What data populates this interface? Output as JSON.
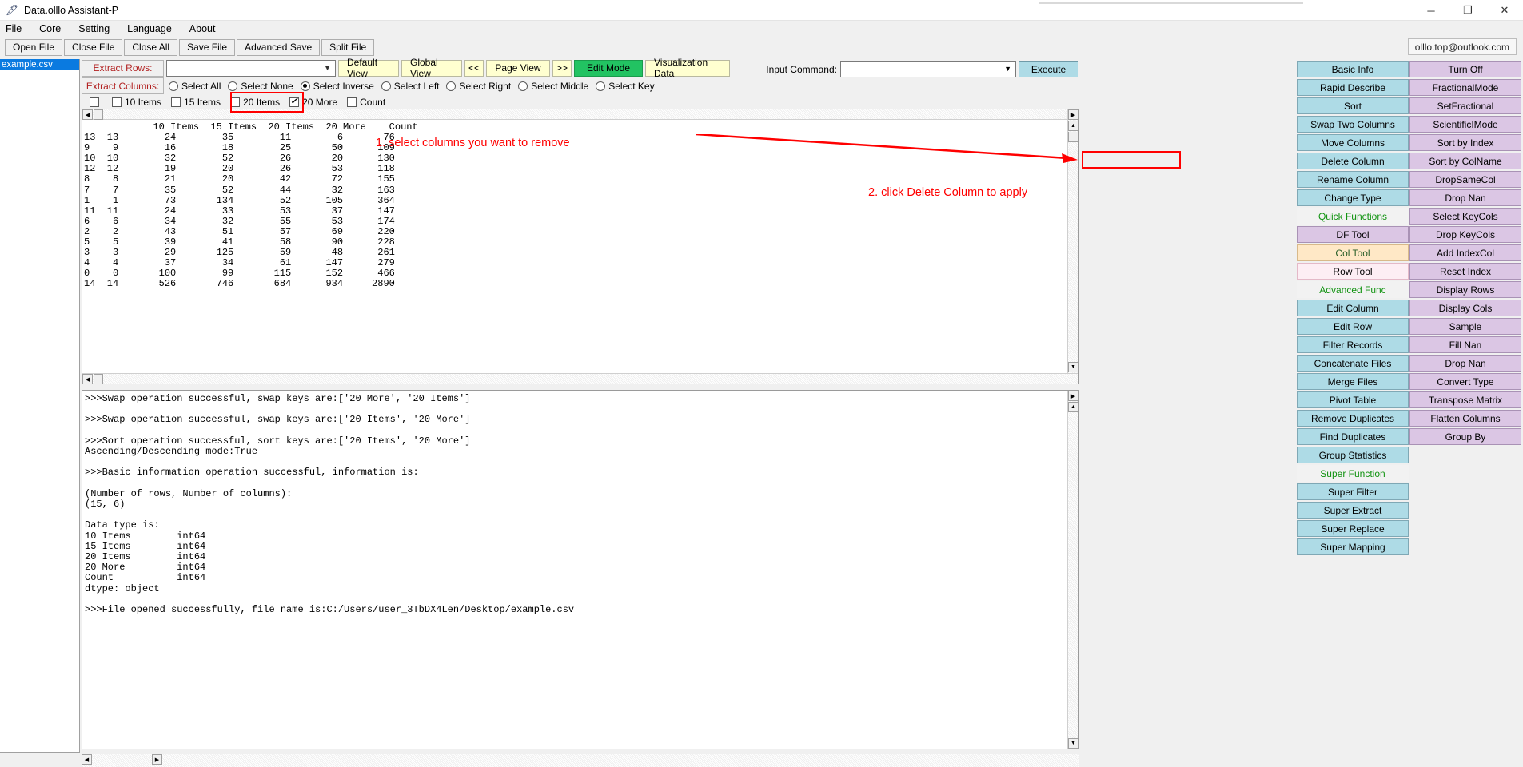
{
  "window": {
    "title": "Data.olllo Assistant-P",
    "app_icon": "feather-icon",
    "minimize": "─",
    "maximize": "❐",
    "close": "✕"
  },
  "menubar": {
    "items": [
      "File",
      "Core",
      "Setting",
      "Language",
      "About"
    ]
  },
  "filebar": {
    "buttons": [
      "Open File",
      "Close File",
      "Close All",
      "Save File",
      "Advanced Save",
      "Split File"
    ],
    "email": "olllo.top@outlook.com"
  },
  "filelist": {
    "items": [
      "example.csv"
    ]
  },
  "extract": {
    "rows_label": "Extract Rows:",
    "rows_value": "",
    "columns_label": "Extract Columns:",
    "view_buttons": [
      "Default View",
      "Global View",
      "<<",
      "Page View",
      ">>"
    ],
    "edit_mode": "Edit Mode",
    "visualization": "Visualization Data",
    "radios": [
      {
        "label": "Select All",
        "selected": false
      },
      {
        "label": "Select None",
        "selected": false
      },
      {
        "label": "Select Inverse",
        "selected": true
      },
      {
        "label": "Select Left",
        "selected": false
      },
      {
        "label": "Select Right",
        "selected": false
      },
      {
        "label": "Select Middle",
        "selected": false
      },
      {
        "label": "Select Key",
        "selected": false
      }
    ],
    "checkboxes": [
      {
        "label": "",
        "checked": false
      },
      {
        "label": "10 Items",
        "checked": false
      },
      {
        "label": "15 Items",
        "checked": false
      },
      {
        "label": "20 Items",
        "checked": false
      },
      {
        "label": "20 More",
        "checked": true
      },
      {
        "label": "Count",
        "checked": false
      }
    ]
  },
  "command": {
    "label": "Input Command:",
    "value": "",
    "execute_label": "Execute"
  },
  "grid": {
    "header": "            10 Items  15 Items  20 Items  20 More    Count",
    "rows": [
      "13  13        24        35        11        6       76",
      "9    9        16        18        25       50      109",
      "10  10        32        52        26       20      130",
      "12  12        19        20        26       53      118",
      "8    8        21        20        42       72      155",
      "7    7        35        52        44       32      163",
      "1    1        73       134        52      105      364",
      "11  11        24        33        53       37      147",
      "6    6        34        32        55       53      174",
      "2    2        43        51        57       69      220",
      "5    5        39        41        58       90      228",
      "3    3        29       125        59       48      261",
      "4    4        37        34        61      147      279",
      "0    0       100        99       115      152      466",
      "14  14       526       746       684      934     2890"
    ]
  },
  "console": {
    "lines": [
      ">>>Swap operation successful, swap keys are:['20 More', '20 Items']",
      "",
      ">>>Swap operation successful, swap keys are:['20 Items', '20 More']",
      "",
      ">>>Sort operation successful, sort keys are:['20 Items', '20 More']",
      "Ascending/Descending mode:True",
      "",
      ">>>Basic information operation successful, information is:",
      "",
      "(Number of rows, Number of columns):",
      "(15, 6)",
      "",
      "Data type is:",
      "10 Items        int64",
      "15 Items        int64",
      "20 Items        int64",
      "20 More         int64",
      "Count           int64",
      "dtype: object",
      "",
      ">>>File opened successfully, file name is:C:/Users/user_3TbDX4Len/Desktop/example.csv"
    ]
  },
  "panel": {
    "left_column": [
      {
        "label": "Basic Info",
        "style": "blue"
      },
      {
        "label": "Rapid Describe",
        "style": "blue"
      },
      {
        "label": "Sort",
        "style": "blue"
      },
      {
        "label": "Swap Two Columns",
        "style": "blue"
      },
      {
        "label": "Move Columns",
        "style": "blue"
      },
      {
        "label": "Delete Column",
        "style": "blue",
        "highlighted": true
      },
      {
        "label": "Rename Column",
        "style": "blue"
      },
      {
        "label": "Change Type",
        "style": "blue"
      },
      {
        "label": "Quick Functions",
        "style": "section"
      },
      {
        "label": "DF Tool",
        "style": "purple"
      },
      {
        "label": "Col Tool",
        "style": "coltool"
      },
      {
        "label": "Row Tool",
        "style": "rowtool"
      },
      {
        "label": "Advanced Func",
        "style": "section"
      },
      {
        "label": "Edit Column",
        "style": "blue"
      },
      {
        "label": "Edit Row",
        "style": "blue"
      },
      {
        "label": "Filter Records",
        "style": "blue"
      },
      {
        "label": "Concatenate Files",
        "style": "blue"
      },
      {
        "label": "Merge Files",
        "style": "blue"
      },
      {
        "label": "Pivot Table",
        "style": "blue"
      },
      {
        "label": "Remove Duplicates",
        "style": "blue"
      },
      {
        "label": "Find Duplicates",
        "style": "blue"
      },
      {
        "label": "Group Statistics",
        "style": "blue"
      },
      {
        "label": "Super Function",
        "style": "section"
      },
      {
        "label": "Super Filter",
        "style": "blue"
      },
      {
        "label": "Super Extract",
        "style": "blue"
      },
      {
        "label": "Super Replace",
        "style": "blue"
      },
      {
        "label": "Super Mapping",
        "style": "blue"
      }
    ],
    "right_column": [
      {
        "label": "Turn Off",
        "style": "purple"
      },
      {
        "label": "FractionalMode",
        "style": "purple"
      },
      {
        "label": "SetFractional",
        "style": "purple"
      },
      {
        "label": "ScientificIMode",
        "style": "purple"
      },
      {
        "label": "Sort by Index",
        "style": "purple"
      },
      {
        "label": "Sort by ColName",
        "style": "purple"
      },
      {
        "label": "DropSameCol",
        "style": "purple"
      },
      {
        "label": "Drop Nan",
        "style": "purple"
      },
      {
        "label": "Select KeyCols",
        "style": "purple"
      },
      {
        "label": "Drop KeyCols",
        "style": "purple"
      },
      {
        "label": "Add IndexCol",
        "style": "purple"
      },
      {
        "label": "Reset Index",
        "style": "purple"
      },
      {
        "label": "Display Rows",
        "style": "purple"
      },
      {
        "label": "Display Cols",
        "style": "purple"
      },
      {
        "label": "Sample",
        "style": "purple"
      },
      {
        "label": "Fill Nan",
        "style": "purple"
      },
      {
        "label": "Drop Nan",
        "style": "purple"
      },
      {
        "label": "Convert Type",
        "style": "purple"
      },
      {
        "label": "Transpose Matrix",
        "style": "purple"
      },
      {
        "label": "Flatten Columns",
        "style": "purple"
      },
      {
        "label": "Group By",
        "style": "purple"
      }
    ]
  },
  "annotations": {
    "step1": "1. select columns you want to remove",
    "step2": "2. click Delete Column to apply"
  },
  "colors": {
    "accent_blue": "#aedbe6",
    "accent_purple": "#dbc6e4",
    "annotation_red": "#ff0000",
    "label_red": "#b22222",
    "edit_mode_green": "#22c362",
    "view_yellow": "#ffffd0"
  }
}
